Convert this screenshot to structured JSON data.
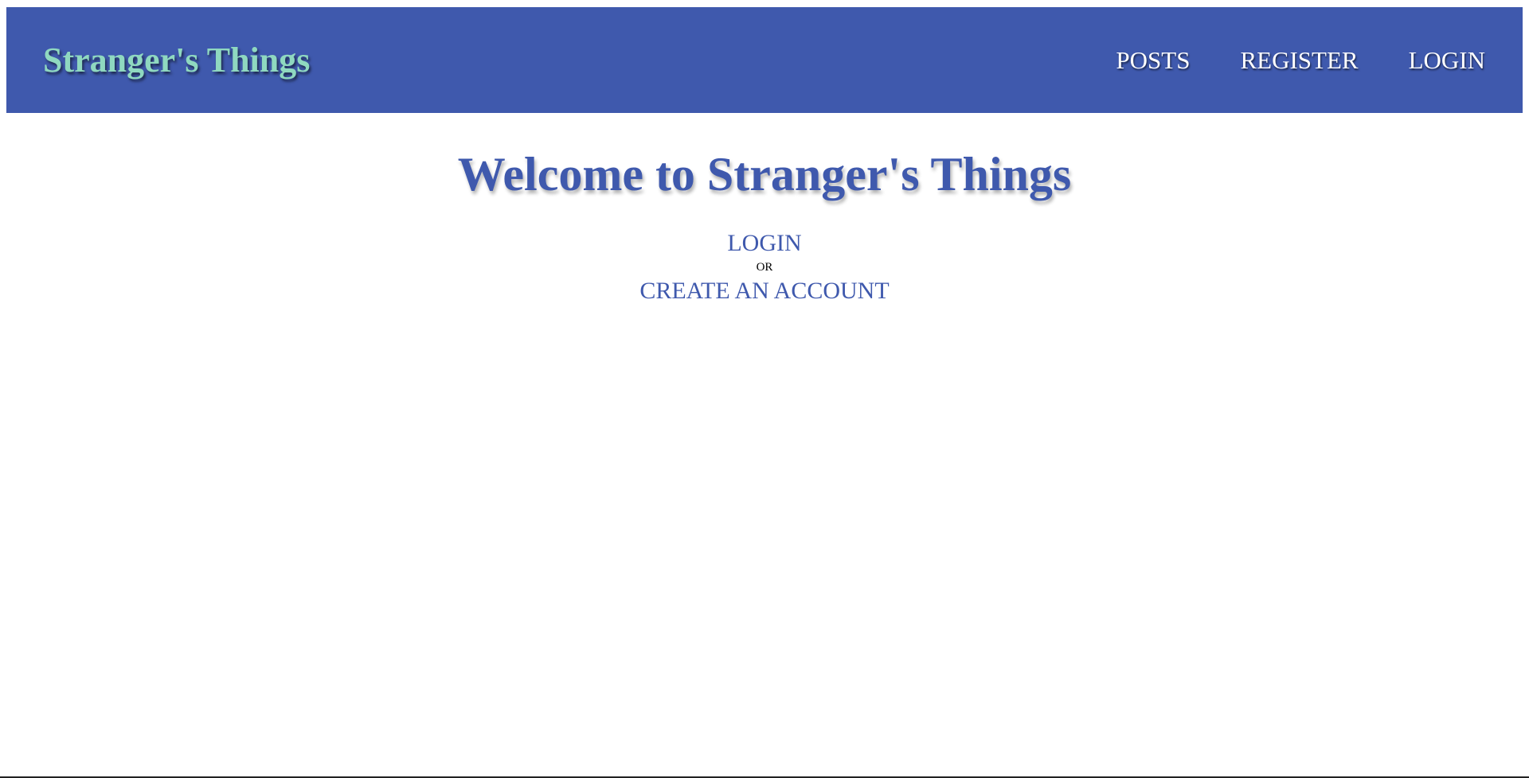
{
  "colors": {
    "navbar_background": "#3f59ad",
    "brand_text": "#8fd8c0",
    "nav_link_text": "#ffffff",
    "accent_text": "#3f59ad",
    "page_background": "#ffffff"
  },
  "navbar": {
    "brand": "Stranger's Things",
    "links": [
      {
        "label": "POSTS"
      },
      {
        "label": "REGISTER"
      },
      {
        "label": "LOGIN"
      }
    ]
  },
  "main": {
    "title": "Welcome to Stranger's Things",
    "login_label": "LOGIN",
    "or_label": "OR",
    "create_account_label": "CREATE AN ACCOUNT"
  }
}
